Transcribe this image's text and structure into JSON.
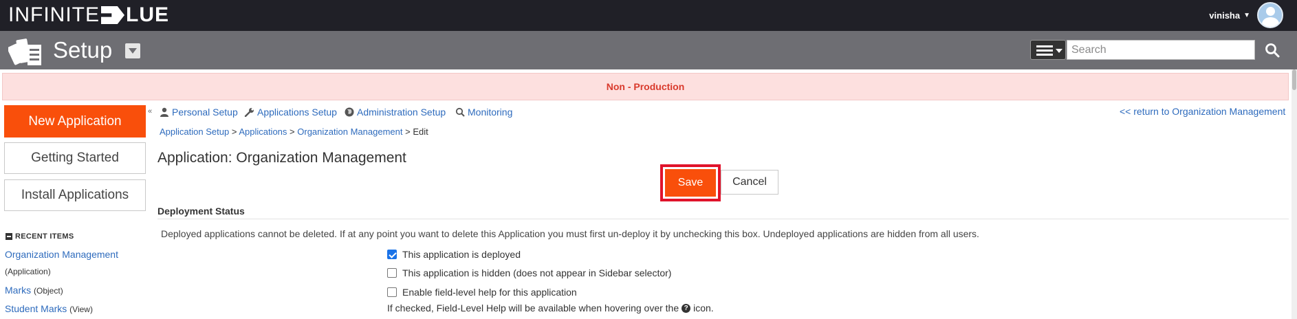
{
  "brand": {
    "logo_thin": "INFINITE",
    "logo_bold": "LUE"
  },
  "user": {
    "name": "vinisha"
  },
  "header": {
    "title": "Setup",
    "search_placeholder": "Search"
  },
  "banner": {
    "text": "Non - Production"
  },
  "sidebar": {
    "new_application": "New Application",
    "getting_started": "Getting Started",
    "install_applications": "Install Applications",
    "collapse_glyph": "«",
    "recent_title": "RECENT ITEMS",
    "recent_items": [
      {
        "name": "Organization Management",
        "kind": "(Application)"
      },
      {
        "name": "Marks",
        "kind": "(Object)"
      },
      {
        "name": "Student Marks",
        "kind": "(View)"
      }
    ]
  },
  "nav": {
    "personal_setup": "Personal Setup",
    "applications_setup": "Applications Setup",
    "administration_setup": "Administration Setup",
    "monitoring": "Monitoring",
    "return_link": "<< return to Organization Management"
  },
  "breadcrumb": {
    "items": [
      "Application Setup",
      "Applications",
      "Organization Management"
    ],
    "separator": ">",
    "current": "Edit"
  },
  "page": {
    "title": "Application: Organization Management"
  },
  "actions": {
    "save": "Save",
    "cancel": "Cancel"
  },
  "deployment": {
    "section_title": "Deployment Status",
    "description": "Deployed applications cannot be deleted. If at any point you want to delete this Application you must first un-deploy it by unchecking this box. Undeployed applications are hidden from all users.",
    "options": [
      {
        "label": "This application is deployed",
        "checked": true
      },
      {
        "label": "This application is hidden (does not appear in Sidebar selector)",
        "checked": false
      },
      {
        "label": "Enable field-level help for this application",
        "checked": false
      }
    ],
    "help_note_before": "If checked, Field-Level Help will be available when hovering over the",
    "help_note_after": "icon."
  },
  "colors": {
    "accent": "#f94f0b",
    "link": "#2e6bbd",
    "banner_bg": "#fde0df",
    "banner_text": "#d93a2c",
    "highlight": "#e0132b"
  }
}
